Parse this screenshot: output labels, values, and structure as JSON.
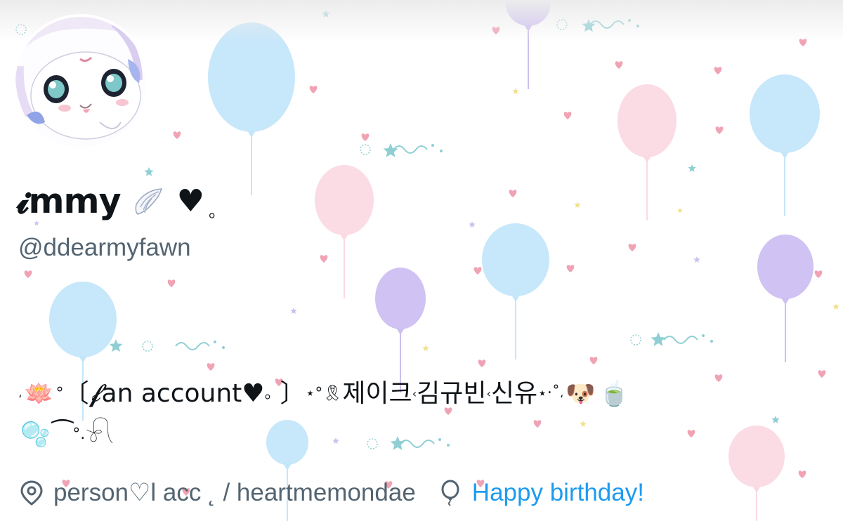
{
  "profile": {
    "display_name": "𝓲mmy",
    "name_heart": "♥",
    "name_dot": "。",
    "handle": "@ddearmyfawn"
  },
  "bio": {
    "line1": [
      {
        "t": "،",
        "c": "tiny"
      },
      {
        "t": "🪷",
        "c": "emoji"
      },
      {
        "t": "°",
        "c": "small"
      },
      {
        "t": "〔",
        "c": ""
      },
      {
        "t": "𝓯an account",
        "c": ""
      },
      {
        "t": " ♥",
        "c": ""
      },
      {
        "t": "。",
        "c": "small"
      },
      {
        "t": "〕",
        "c": ""
      },
      {
        "t": "⋆",
        "c": "small"
      },
      {
        "t": " °",
        "c": "small"
      },
      {
        "t": "🎗",
        "c": "small"
      },
      {
        "t": "제이크",
        "c": ""
      },
      {
        "t": "‹",
        "c": "tiny"
      },
      {
        "t": "김규빈",
        "c": ""
      },
      {
        "t": "‹",
        "c": "tiny"
      },
      {
        "t": "신유",
        "c": ""
      },
      {
        "t": "⋆‧˚",
        "c": "small"
      },
      {
        "t": "،",
        "c": "tiny"
      },
      {
        "t": "🐶",
        "c": "emoji"
      },
      {
        "t": "🍵",
        "c": "emoji"
      }
    ],
    "line2": [
      {
        "t": "🫧",
        "c": "emoji"
      },
      {
        "t": "⁀",
        "c": ""
      },
      {
        "t": "°.",
        "c": "small"
      },
      {
        "t": "𓍯",
        "c": ""
      }
    ]
  },
  "meta": {
    "location_icon": "location-pin-icon",
    "location": "person♡l acc ˛ / heartmemondae",
    "birthday_icon": "balloon-icon",
    "birthday": "Happy birthday!"
  },
  "colors": {
    "balloon_blue": "#c4e6fb",
    "balloon_pink": "#fbd9e3",
    "balloon_purple": "#cdbff1",
    "heart_pink": "#f0a3b4",
    "star_teal": "#8fcfd4",
    "star_yellow": "#f3e08a",
    "link": "#1d9bf0",
    "secondary_text": "#536471"
  }
}
